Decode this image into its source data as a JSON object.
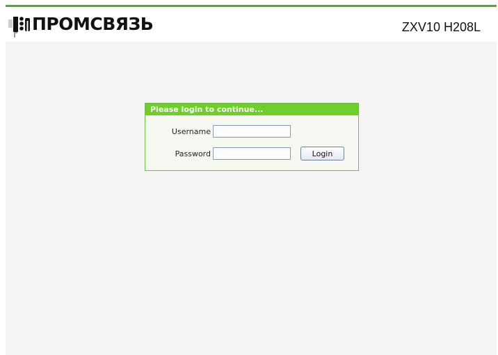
{
  "header": {
    "logo_text": "ПРОМСВЯЗЬ",
    "model": "ZXV10 H208L"
  },
  "login": {
    "title": "Please login to continue...",
    "username_label": "Username",
    "username_value": "",
    "password_label": "Password",
    "password_value": "",
    "login_button": "Login"
  },
  "colors": {
    "accent": "#6fce2b",
    "topbar": "#4caf2a",
    "background": "#f4f4f4"
  }
}
